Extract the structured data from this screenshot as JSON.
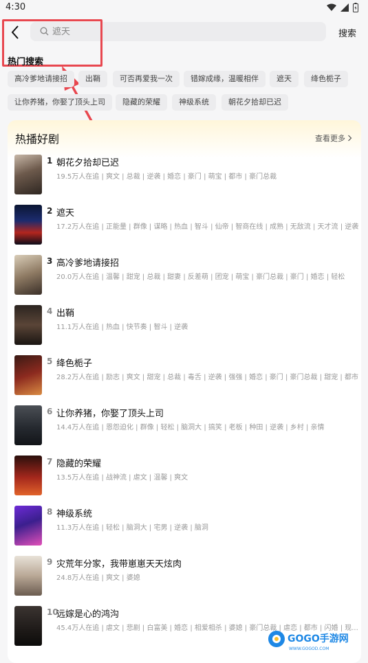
{
  "status": {
    "time": "4:30"
  },
  "search": {
    "placeholder": "遮天",
    "action_label": "搜索"
  },
  "hot_search": {
    "title": "热门搜索",
    "chips": [
      "高冷爹地请接招",
      "出鞘",
      "可否再爱我一次",
      "错嫁成缘，温暖相伴",
      "遮天",
      "绛色栀子",
      "让你养猪，你娶了顶头上司",
      "隐藏的荣耀",
      "神级系统",
      "朝花夕拾却已迟"
    ]
  },
  "ranking": {
    "title": "热播好剧",
    "more_label": "查看更多",
    "items": [
      {
        "rank": "1",
        "title": "朝花夕拾却已迟",
        "meta": "19.5万人在追 | 爽文 | 总裁 | 逆袭 | 婚恋 | 豪门 | 萌宝 | 都市 | 豪门总裁"
      },
      {
        "rank": "2",
        "title": "遮天",
        "meta": "17.2万人在追 | 正能量 | 群像 | 谋略 | 热血 | 智斗 | 仙帝 | 智商在线 | 成熟 | 无敌流 | 天才流 | 逆袭"
      },
      {
        "rank": "3",
        "title": "高冷爹地请接招",
        "meta": "20.0万人在追 | 温馨 | 甜宠 | 总裁 | 甜妻 | 反差萌 | 团宠 | 萌宝 | 豪门总裁 | 豪门 | 婚恋 | 轻松"
      },
      {
        "rank": "4",
        "title": "出鞘",
        "meta": "11.1万人在追 | 热血 | 快节奏 | 智斗 | 逆袭"
      },
      {
        "rank": "5",
        "title": "绛色栀子",
        "meta": "28.2万人在追 | 励志 | 爽文 | 甜宠 | 总裁 | 毒舌 | 逆袭 | 强强 | 婚恋 | 豪门 | 豪门总裁 | 甜宠 | 都市"
      },
      {
        "rank": "6",
        "title": "让你养猪，你娶了顶头上司",
        "meta": "14.4万人在追 | 恩怨迫化 | 群像 | 轻松 | 脑洞大 | 搞笑 | 老板 | 种田 | 逆袭 | 乡村 | 亲情"
      },
      {
        "rank": "7",
        "title": "隐藏的荣耀",
        "meta": "13.5万人在追 | 战神流 | 虐文 | 温馨 | 爽文"
      },
      {
        "rank": "8",
        "title": "神级系统",
        "meta": "11.3万人在追 | 轻松 | 脑洞大 | 宅男 | 逆袭 | 脑洞"
      },
      {
        "rank": "9",
        "title": "灾荒年分家，我带崽崽天天炫肉",
        "meta": "24.8万人在追 | 爽文 | 婆媳"
      },
      {
        "rank": "10",
        "title": "远嫁是心的鸿沟",
        "meta": "45.4万人在追 | 虐文 | 悲剧 | 白富美 | 婚恋 | 相爱相杀 | 婆媳 | 豪门总裁 | 虐恋 | 都市 | 闪婚 | 现..."
      }
    ]
  },
  "watermark": {
    "brand": "GOGO手游网",
    "url": "WWW.GOGOD.COM"
  },
  "colors": {
    "annotation": "#e8474f",
    "card_gradient_top": "#fff6da",
    "chip_bg": "#ececee"
  }
}
